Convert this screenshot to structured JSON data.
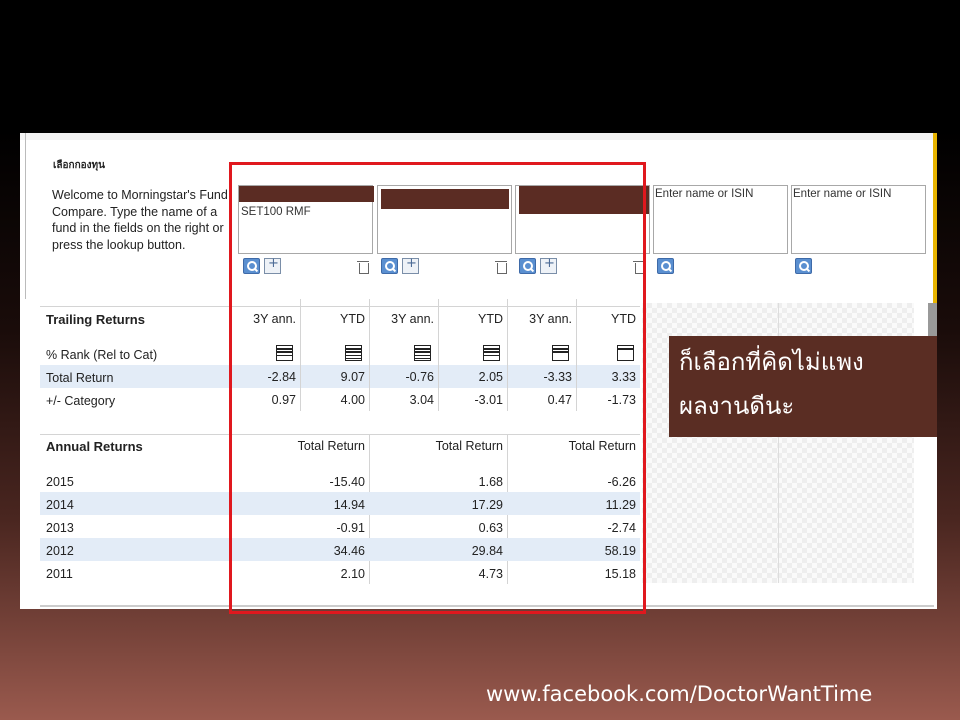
{
  "fund_compare": {
    "select_title": "เลือกกองทุน",
    "welcome_text": "Welcome to Morningstar's Fund Compare. Type the name of a fund in the fields on the right or press the lookup button.",
    "funds": [
      {
        "name_line": "SET100 RMF",
        "redacted": true
      },
      {
        "name_line": "",
        "redacted": true
      },
      {
        "name_line": "",
        "redacted": true
      },
      {
        "placeholder": "Enter name or ISIN"
      },
      {
        "placeholder": "Enter name or ISIN"
      }
    ],
    "icons": {
      "search": "search-icon",
      "add": "add-icon",
      "delete": "trash-icon"
    }
  },
  "trailing": {
    "title": "Trailing Returns",
    "col_headers": [
      "3Y ann.",
      "YTD",
      "3Y ann.",
      "YTD",
      "3Y ann.",
      "YTD"
    ],
    "rank_label": "% Rank (Rel to Cat)",
    "rank_levels": [
      3,
      4,
      4,
      3,
      2,
      1
    ],
    "total_return_label": "Total Return",
    "total_return": [
      "-2.84",
      "9.07",
      "-0.76",
      "2.05",
      "-3.33",
      "3.33"
    ],
    "category_label": "+/- Category",
    "category": [
      "0.97",
      "4.00",
      "3.04",
      "-3.01",
      "0.47",
      "-1.73"
    ]
  },
  "annual": {
    "title": "Annual Returns",
    "col_header": "Total Return",
    "years": [
      "2015",
      "2014",
      "2013",
      "2012",
      "2011"
    ],
    "fund1": [
      "-15.40",
      "14.94",
      "-0.91",
      "34.46",
      "2.10"
    ],
    "fund2": [
      "1.68",
      "17.29",
      "0.63",
      "29.84",
      "4.73"
    ],
    "fund3": [
      "-6.26",
      "11.29",
      "-2.74",
      "58.19",
      "15.18"
    ]
  },
  "callout": {
    "line1": "ก็เลือกที่คิดไม่แพง",
    "line2": "ผลงานดีนะ"
  },
  "footer": {
    "url": "www.facebook.com/DoctorWantTime"
  },
  "colors": {
    "highlight_frame": "#e0181e",
    "callout_bg": "#5a2d23",
    "redaction": "#5b2c23",
    "row_band": "#e3ecf7"
  }
}
